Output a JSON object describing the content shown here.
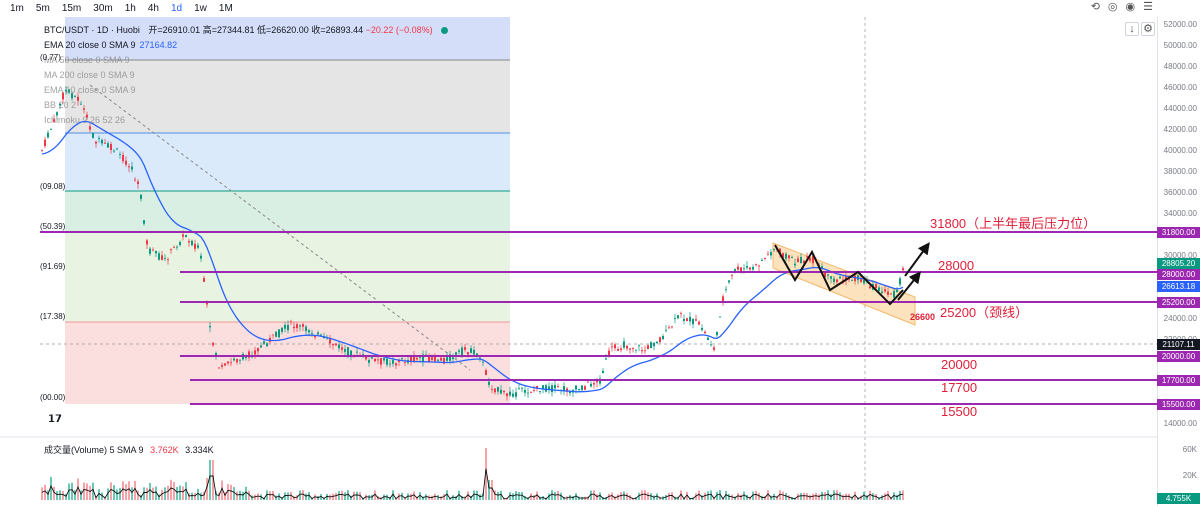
{
  "toolbar": {
    "timeframes": [
      "1m",
      "5m",
      "15m",
      "30m",
      "1h",
      "4h",
      "1d",
      "1w",
      "1M"
    ],
    "active": "1d",
    "tools": [
      "⟲",
      "◎",
      "◉",
      "☰"
    ]
  },
  "legend": {
    "symbol": "BTC/USDT · 1D · Huobi",
    "open": "开=26910.01",
    "high": "高=27344.81",
    "low": "低=26620.00",
    "close": "收=26893.44",
    "change": "−20.22 (−0.08%)",
    "indicators": [
      {
        "label": "EMA 20 close 0 SMA 9",
        "value": "27164.82"
      },
      {
        "label": "MA 50 close 0 SMA 9",
        "value": ""
      },
      {
        "label": "MA 200 close 0 SMA 9",
        "value": ""
      },
      {
        "label": "EMA 10 close 0 SMA 9",
        "value": ""
      },
      {
        "label": "BB 20 2",
        "value": ""
      },
      {
        "label": "Ichimoku 9 26 52 26",
        "value": ""
      }
    ]
  },
  "fib_labels": [
    "(0.77)",
    "(09.08)",
    "(50.39)",
    "(91.69)",
    "(17.38)",
    "(00.00)"
  ],
  "volume": {
    "label": "成交量(Volume)",
    "sma": "5 SMA 9",
    "value1": "3.762K",
    "value2": "3.334K",
    "axis": [
      "60K",
      "20K"
    ],
    "current": "4.755K"
  },
  "yaxis_ticks": [
    "52000.00",
    "50000.00",
    "48000.00",
    "46000.00",
    "44000.00",
    "42000.00",
    "40000.00",
    "38000.00",
    "36000.00",
    "34000.00",
    "30000.00",
    "24000.00",
    "22000.00",
    "18000.00",
    "14000.00"
  ],
  "price_labels": {
    "l31800": "31800.00",
    "l28805": "28805.20",
    "l28000": "28000.00",
    "l26613": "26613.18",
    "l25200": "25200.00",
    "l21107": "21107.11",
    "l20000": "20000.00",
    "l17700": "17700.00",
    "l15500": "15500.00"
  },
  "annotations": {
    "a31800": "31800（上半年最后压力位）",
    "a28000": "28000",
    "a26600": "26600",
    "a25200": "25200（颈线）",
    "a20000": "20000",
    "a17700": "17700",
    "a15500": "15500"
  },
  "colors": {
    "level_line": "#9c27b0",
    "ema": "#2962ff",
    "annotation": "#e0203a",
    "up": "#089981",
    "down": "#f23645"
  }
}
